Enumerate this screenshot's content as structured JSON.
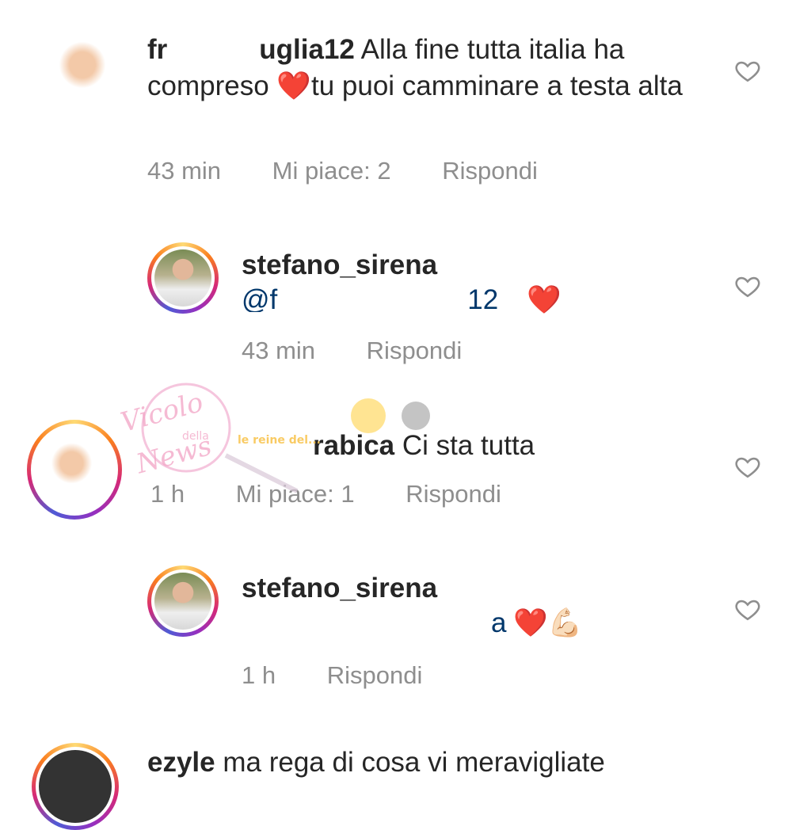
{
  "comments": [
    {
      "username": "fr",
      "username_suffix": "uglia12",
      "text_before_heart": " Alla fine tutta italia ha compreso ",
      "heart": "❤️",
      "text_after_heart": "tu puoi camminare a testa alta",
      "time": "43 min",
      "likes": "Mi piace: 2",
      "reply": "Rispondi"
    },
    {
      "username": "stefano_sirena",
      "mention_partial": "@f",
      "mention_tail": "12",
      "emoji": "❤️",
      "time": "43 min",
      "reply": "Rispondi"
    },
    {
      "username_suffix": "rabica",
      "text": "Ci sta tutta",
      "time": "1 h",
      "likes": "Mi piace: 1",
      "reply": "Rispondi"
    },
    {
      "username": "stefano_sirena",
      "mention_tail": "a",
      "emoji": "❤️💪🏻",
      "time": "1 h",
      "reply": "Rispondi"
    },
    {
      "username": "ezyle",
      "text": "ma rega di cosa vi meravigliate"
    }
  ],
  "watermark": {
    "line1": "Vicolo",
    "line2": "della",
    "line3": "News",
    "brand": "le reine del..."
  },
  "colors": {
    "text": "#262626",
    "meta": "#8e8e8e",
    "heart": "#d0021b"
  }
}
